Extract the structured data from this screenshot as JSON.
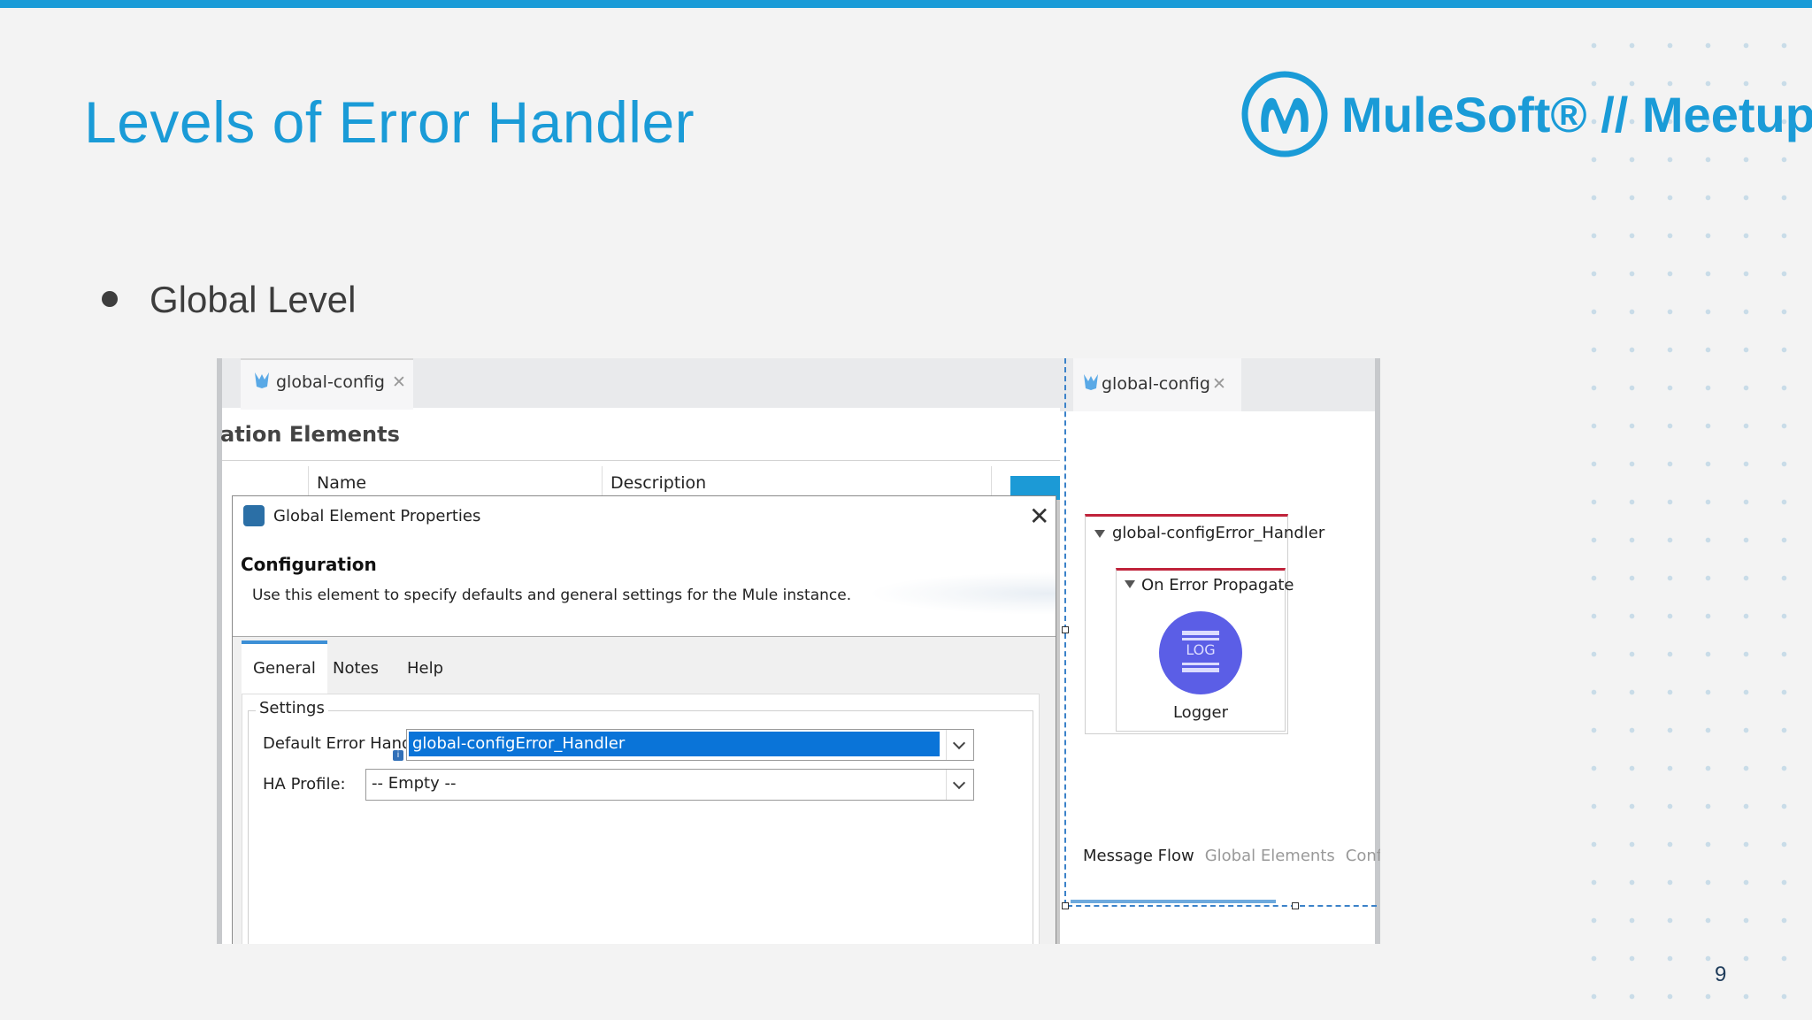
{
  "slide": {
    "title": "Levels of Error Handler",
    "bullet": "Global Level",
    "page_number": "9",
    "logo_text": "MuleSoft® // Meetups",
    "accent_color": "#1a9bd7"
  },
  "left_screenshot": {
    "tab_label": "global-config",
    "heading": "ation Elements",
    "columns": [
      "Name",
      "Description"
    ],
    "dialog": {
      "title": "Global Element Properties",
      "heading": "Configuration",
      "description": "Use this element to specify defaults and general settings for the Mule instance.",
      "tabs": [
        "General",
        "Notes",
        "Help"
      ],
      "active_tab": "General",
      "settings_legend": "Settings",
      "fields": {
        "default_error_handler_label": "Default Error Handler:",
        "default_error_handler_value": "global-configError_Handler",
        "ha_profile_label": "HA Profile:",
        "ha_profile_value": "-- Empty --"
      }
    }
  },
  "right_screenshot": {
    "tab_label": "global-config",
    "flow_title": "global-configError_Handler",
    "scope_title": "On Error Propagate",
    "component_icon_text": "LOG",
    "component_label": "Logger",
    "bottom_tabs": [
      "Message Flow",
      "Global Elements",
      "Confi"
    ]
  }
}
